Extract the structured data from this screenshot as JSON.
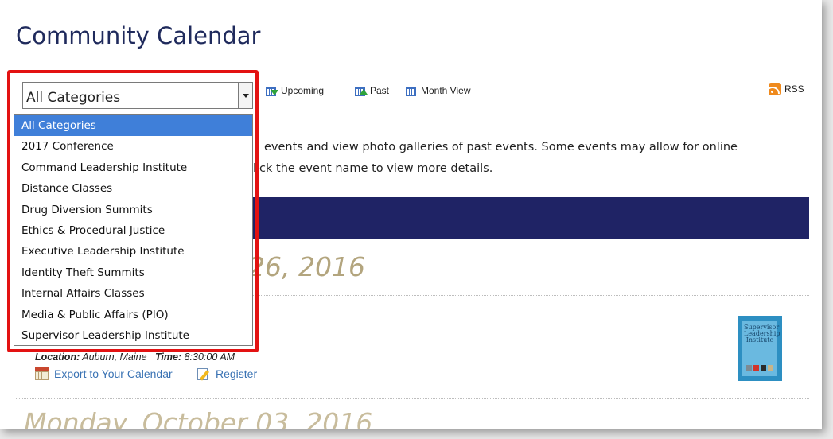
{
  "page": {
    "title": "Community Calendar"
  },
  "toolbar": {
    "upcoming_label": "Upcoming",
    "past_label": "Past",
    "month_view_label": "Month View",
    "rss_label": "RSS"
  },
  "category_select": {
    "selected": "All Categories",
    "options": [
      "All Categories",
      "2017 Conference",
      "Command Leadership Institute",
      "Distance Classes",
      "Drug Diversion Summits",
      "Ethics & Procedural Justice",
      "Executive Leadership Institute",
      "Identity Theft Summits",
      "Internal Affairs Classes",
      "Media & Public Affairs (PIO)",
      "Supervisor Leadership Institute"
    ]
  },
  "intro": {
    "line1": "events and view photo galleries of past events. Some events may allow for online",
    "line2": "lick the event name to view more details."
  },
  "event_day": {
    "date_fragment": "26, 2016"
  },
  "event": {
    "location_label": "Location:",
    "location": "Auburn, Maine",
    "time_label": "Time:",
    "time": "8:30:00 AM",
    "export_label": "Export to Your Calendar",
    "register_label": "Register",
    "logo_text": "Supervisor Leadership Institute"
  },
  "next_event_day": {
    "date": "Monday, October 03, 2016"
  },
  "colors": {
    "title": "#1f2a5c",
    "banner": "#1f2365",
    "date_heading": "#b3a57e",
    "link": "#3a73b4",
    "highlight": "#e31212",
    "selected_option": "#3f7fd9"
  }
}
